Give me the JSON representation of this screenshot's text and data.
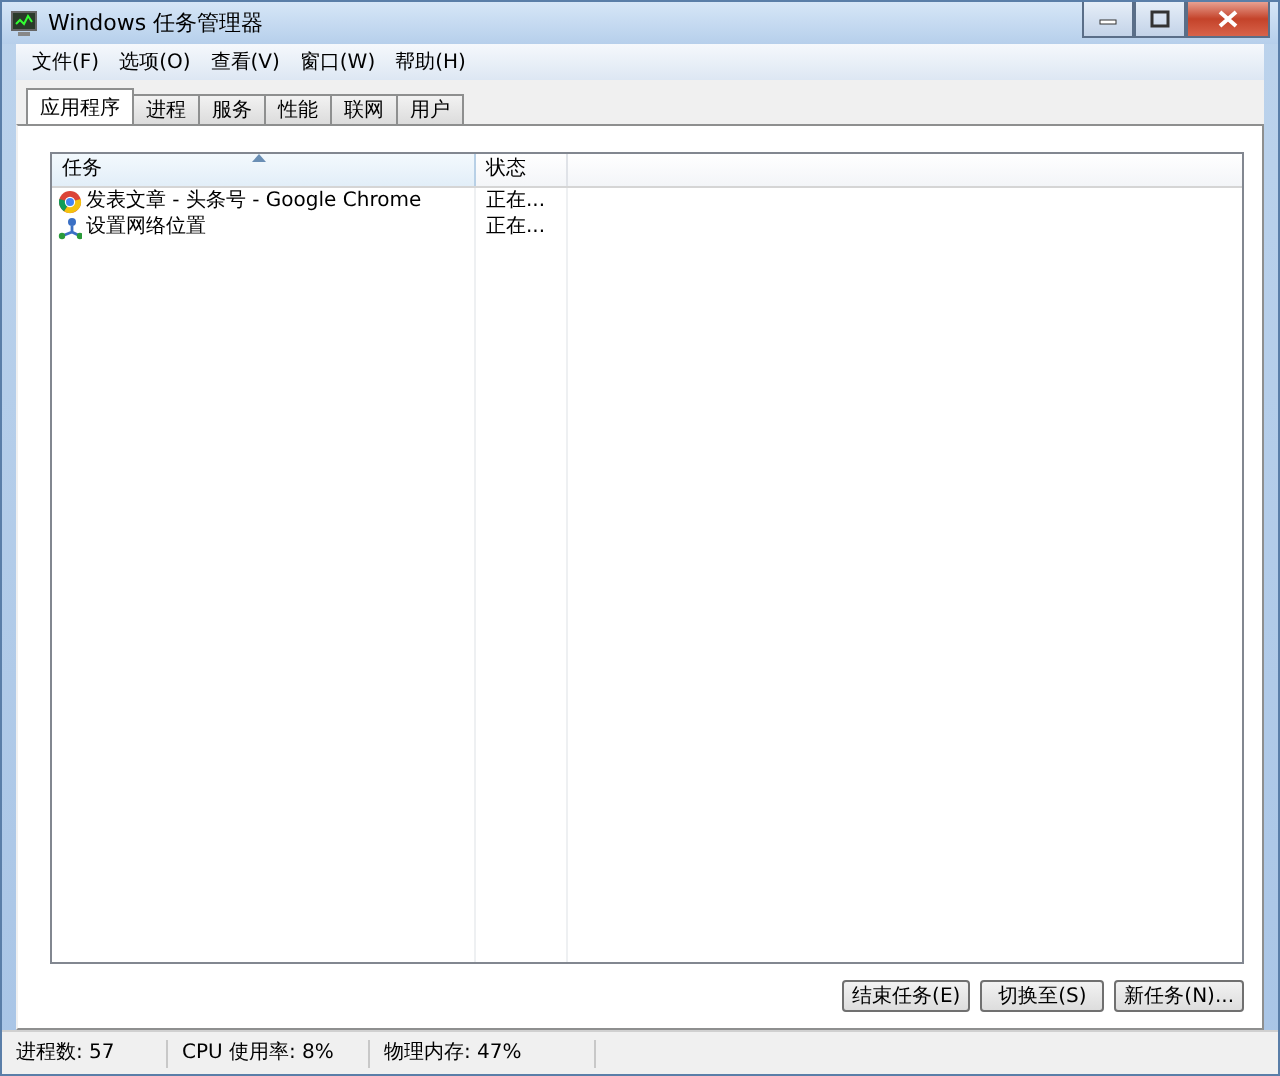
{
  "window": {
    "title": "Windows 任务管理器"
  },
  "menu": [
    "文件(F)",
    "选项(O)",
    "查看(V)",
    "窗口(W)",
    "帮助(H)"
  ],
  "tabs": [
    {
      "label": "应用程序",
      "selected": true
    },
    {
      "label": "进程",
      "selected": false
    },
    {
      "label": "服务",
      "selected": false
    },
    {
      "label": "性能",
      "selected": false
    },
    {
      "label": "联网",
      "selected": false
    },
    {
      "label": "用户",
      "selected": false
    }
  ],
  "table": {
    "columns": [
      "任务",
      "状态"
    ],
    "rows": [
      {
        "kind": "browser",
        "task": "发表文章 - 头条号 - Google Chrome",
        "status": "正在..."
      },
      {
        "kind": "network",
        "task": "设置网络位置",
        "status": "正在..."
      }
    ]
  },
  "buttons": [
    "结束任务(E)",
    "切换至(S)",
    "新任务(N)..."
  ],
  "status_bar": [
    "进程数: 57",
    "CPU 使用率: 8%",
    "物理内存: 47%"
  ]
}
